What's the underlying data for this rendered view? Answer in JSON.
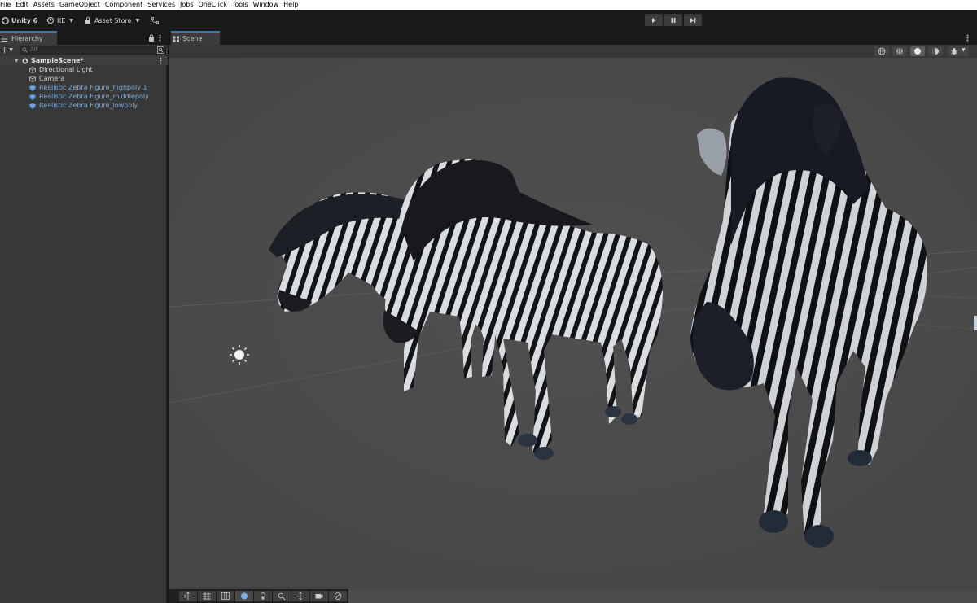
{
  "menu": [
    "File",
    "Edit",
    "Assets",
    "GameObject",
    "Component",
    "Services",
    "Jobs",
    "OneClick",
    "Tools",
    "Window",
    "Help"
  ],
  "toolbar": {
    "app_label": "Unity 6",
    "account_label": "KE",
    "asset_store_label": "Asset Store"
  },
  "tabs": {
    "hierarchy": "Hierarchy",
    "scene": "Scene"
  },
  "hierarchy": {
    "search_placeholder": "All",
    "scene_name": "SampleScene*",
    "items": [
      {
        "label": "Directional Light",
        "kind": "gameobject"
      },
      {
        "label": "Camera",
        "kind": "gameobject"
      },
      {
        "label": "Realistic Zebra Figure_highpoly 1",
        "kind": "prefab"
      },
      {
        "label": "Realistic Zebra Figure_middlepoly",
        "kind": "prefab"
      },
      {
        "label": "Realistic Zebra Figure_lowpoly",
        "kind": "prefab"
      }
    ]
  },
  "scene": {
    "objects": [
      "zebra-lowpoly",
      "zebra-middlepoly",
      "zebra-highpoly",
      "directional-light-gizmo"
    ]
  },
  "colors": {
    "accent": "#3a79bb",
    "prefab_text": "#7cabdf",
    "scene_bg": "#4b4b4b",
    "panel_bg": "#383838"
  }
}
